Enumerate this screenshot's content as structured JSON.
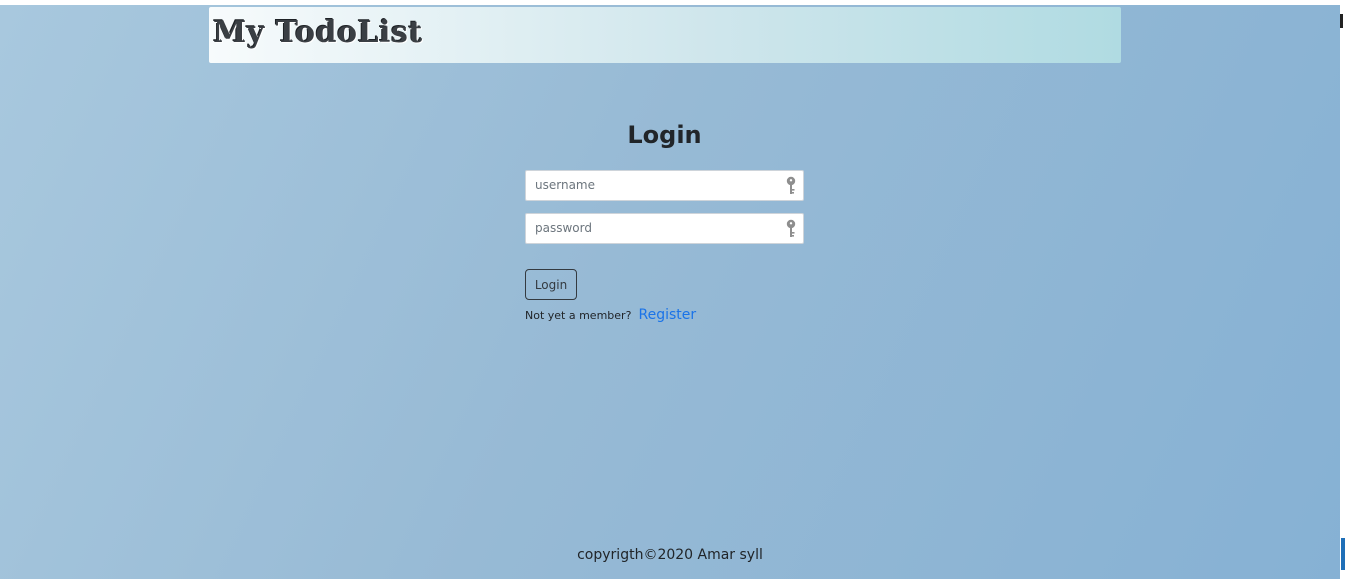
{
  "header": {
    "brand": "My TodoList"
  },
  "login": {
    "title": "Login",
    "username": {
      "placeholder": "username",
      "value": ""
    },
    "password": {
      "placeholder": "password",
      "value": ""
    },
    "field_icon": "key-icon",
    "submit_label": "Login",
    "not_member_text": "Not yet a member?",
    "register_link": "Register"
  },
  "footer": {
    "text": "copyrigth©2020 Amar syll"
  },
  "colors": {
    "link": "#1a73e8",
    "text": "#212529",
    "button_border": "#343a40",
    "header_gradient_start": "#f7fbfc",
    "header_gradient_end": "#b0dbe2"
  }
}
